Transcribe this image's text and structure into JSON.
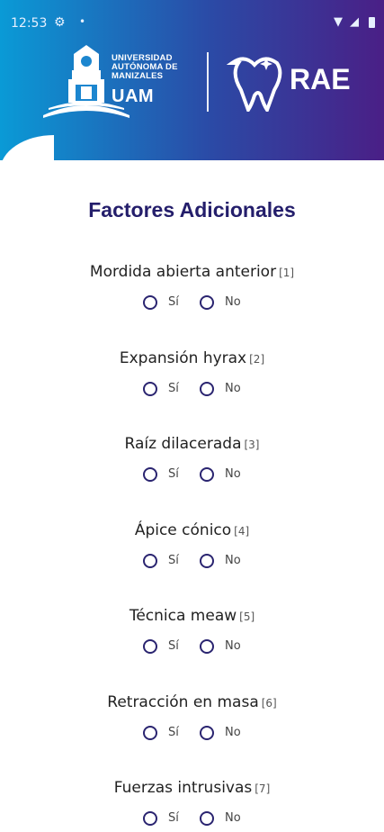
{
  "status_bar": {
    "time": "12:53"
  },
  "brand": {
    "university_line1": "UNIVERSIDAD",
    "university_line2": "AUTÓNOMA DE",
    "university_line3": "MANIZALES",
    "uam": "UAM",
    "app_name": "RAE"
  },
  "title": "Factores Adicionales",
  "option_labels": {
    "yes": "Sí",
    "no": "No"
  },
  "questions": [
    {
      "label": "Mordida abierta anterior",
      "ref": "[1]"
    },
    {
      "label": "Expansión hyrax",
      "ref": "[2]"
    },
    {
      "label": "Raíz dilacerada",
      "ref": "[3]"
    },
    {
      "label": "Ápice cónico",
      "ref": "[4]"
    },
    {
      "label": "Técnica meaw",
      "ref": "[5]"
    },
    {
      "label": "Retracción en masa",
      "ref": "[6]"
    },
    {
      "label": "Fuerzas intrusivas",
      "ref": "[7]"
    }
  ],
  "colors": {
    "header_start": "#0a9ad6",
    "header_end": "#4a1f86",
    "title": "#241e6b",
    "radio": "#2a2470"
  }
}
